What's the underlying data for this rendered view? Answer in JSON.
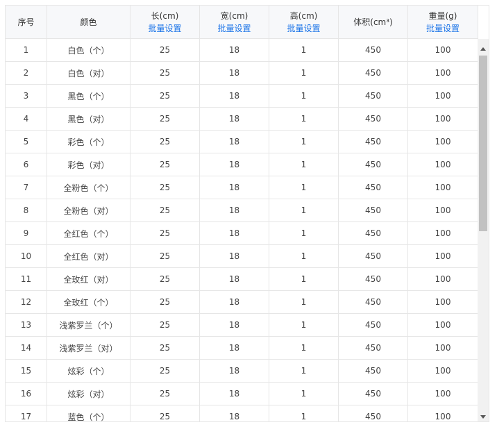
{
  "table": {
    "headers": [
      {
        "title": "序号",
        "batch": ""
      },
      {
        "title": "颜色",
        "batch": ""
      },
      {
        "title": "长(cm)",
        "batch": "批量设置"
      },
      {
        "title": "宽(cm)",
        "batch": "批量设置"
      },
      {
        "title": "高(cm)",
        "batch": "批量设置"
      },
      {
        "title": "体积(cm³)",
        "batch": ""
      },
      {
        "title": "重量(g)",
        "batch": "批量设置"
      }
    ],
    "rows": [
      {
        "no": "1",
        "color": "白色（个）",
        "length": "25",
        "width": "18",
        "height": "1",
        "volume": "450",
        "weight": "100"
      },
      {
        "no": "2",
        "color": "白色（对）",
        "length": "25",
        "width": "18",
        "height": "1",
        "volume": "450",
        "weight": "100"
      },
      {
        "no": "3",
        "color": "黑色（个）",
        "length": "25",
        "width": "18",
        "height": "1",
        "volume": "450",
        "weight": "100"
      },
      {
        "no": "4",
        "color": "黑色（对）",
        "length": "25",
        "width": "18",
        "height": "1",
        "volume": "450",
        "weight": "100"
      },
      {
        "no": "5",
        "color": "彩色（个）",
        "length": "25",
        "width": "18",
        "height": "1",
        "volume": "450",
        "weight": "100"
      },
      {
        "no": "6",
        "color": "彩色（对）",
        "length": "25",
        "width": "18",
        "height": "1",
        "volume": "450",
        "weight": "100"
      },
      {
        "no": "7",
        "color": "全粉色（个）",
        "length": "25",
        "width": "18",
        "height": "1",
        "volume": "450",
        "weight": "100"
      },
      {
        "no": "8",
        "color": "全粉色（对）",
        "length": "25",
        "width": "18",
        "height": "1",
        "volume": "450",
        "weight": "100"
      },
      {
        "no": "9",
        "color": "全红色（个）",
        "length": "25",
        "width": "18",
        "height": "1",
        "volume": "450",
        "weight": "100"
      },
      {
        "no": "10",
        "color": "全红色（对）",
        "length": "25",
        "width": "18",
        "height": "1",
        "volume": "450",
        "weight": "100"
      },
      {
        "no": "11",
        "color": "全玫红（对）",
        "length": "25",
        "width": "18",
        "height": "1",
        "volume": "450",
        "weight": "100"
      },
      {
        "no": "12",
        "color": "全玫红（个）",
        "length": "25",
        "width": "18",
        "height": "1",
        "volume": "450",
        "weight": "100"
      },
      {
        "no": "13",
        "color": "浅紫罗兰（个）",
        "length": "25",
        "width": "18",
        "height": "1",
        "volume": "450",
        "weight": "100"
      },
      {
        "no": "14",
        "color": "浅紫罗兰（对）",
        "length": "25",
        "width": "18",
        "height": "1",
        "volume": "450",
        "weight": "100"
      },
      {
        "no": "15",
        "color": "炫彩（个）",
        "length": "25",
        "width": "18",
        "height": "1",
        "volume": "450",
        "weight": "100"
      },
      {
        "no": "16",
        "color": "炫彩（对）",
        "length": "25",
        "width": "18",
        "height": "1",
        "volume": "450",
        "weight": "100"
      },
      {
        "no": "17",
        "color": "蓝色（个）",
        "length": "25",
        "width": "18",
        "height": "1",
        "volume": "450",
        "weight": "100"
      }
    ]
  }
}
